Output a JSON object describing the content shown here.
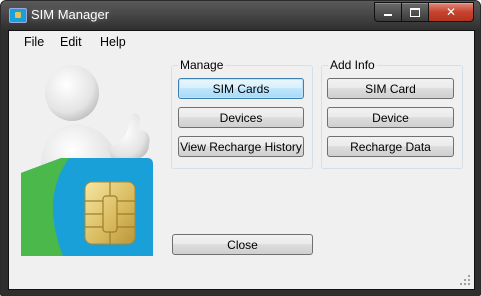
{
  "window": {
    "title": "SIM Manager"
  },
  "menu": {
    "items": [
      "File",
      "Edit",
      "Help"
    ]
  },
  "manage": {
    "label": "Manage",
    "buttons": [
      "SIM Cards",
      "Devices",
      "View Recharge History"
    ]
  },
  "add_info": {
    "label": "Add Info",
    "buttons": [
      "SIM Card",
      "Device",
      "Recharge Data"
    ]
  },
  "close_button": "Close",
  "icons": {
    "app": "sim-card-icon",
    "minimize": "minimize-icon",
    "maximize": "maximize-icon",
    "close": "close-icon",
    "figure": "person-thumbs-up-with-sim-card-illustration",
    "resize": "resize-grip-icon"
  },
  "colors": {
    "sim_blue": "#1aa0d8",
    "sim_green": "#4ab84a",
    "chip_gold": "#dcc06a",
    "focus_border": "#3c7fb1"
  }
}
